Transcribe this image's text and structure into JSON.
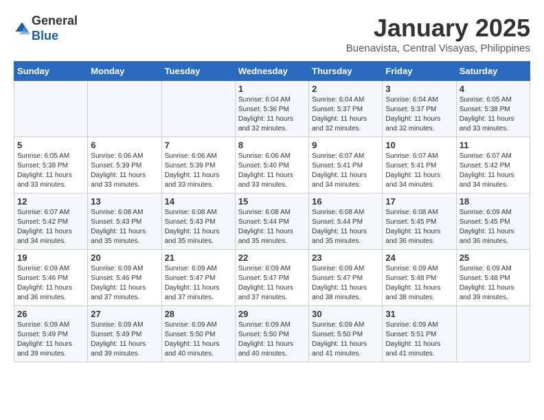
{
  "header": {
    "logo_general": "General",
    "logo_blue": "Blue",
    "month_title": "January 2025",
    "location": "Buenavista, Central Visayas, Philippines"
  },
  "days_of_week": [
    "Sunday",
    "Monday",
    "Tuesday",
    "Wednesday",
    "Thursday",
    "Friday",
    "Saturday"
  ],
  "weeks": [
    [
      {
        "day": "",
        "info": ""
      },
      {
        "day": "",
        "info": ""
      },
      {
        "day": "",
        "info": ""
      },
      {
        "day": "1",
        "info": "Sunrise: 6:04 AM\nSunset: 5:36 PM\nDaylight: 11 hours and 32 minutes."
      },
      {
        "day": "2",
        "info": "Sunrise: 6:04 AM\nSunset: 5:37 PM\nDaylight: 11 hours and 32 minutes."
      },
      {
        "day": "3",
        "info": "Sunrise: 6:04 AM\nSunset: 5:37 PM\nDaylight: 11 hours and 32 minutes."
      },
      {
        "day": "4",
        "info": "Sunrise: 6:05 AM\nSunset: 5:38 PM\nDaylight: 11 hours and 33 minutes."
      }
    ],
    [
      {
        "day": "5",
        "info": "Sunrise: 6:05 AM\nSunset: 5:38 PM\nDaylight: 11 hours and 33 minutes."
      },
      {
        "day": "6",
        "info": "Sunrise: 6:06 AM\nSunset: 5:39 PM\nDaylight: 11 hours and 33 minutes."
      },
      {
        "day": "7",
        "info": "Sunrise: 6:06 AM\nSunset: 5:39 PM\nDaylight: 11 hours and 33 minutes."
      },
      {
        "day": "8",
        "info": "Sunrise: 6:06 AM\nSunset: 5:40 PM\nDaylight: 11 hours and 33 minutes."
      },
      {
        "day": "9",
        "info": "Sunrise: 6:07 AM\nSunset: 5:41 PM\nDaylight: 11 hours and 34 minutes."
      },
      {
        "day": "10",
        "info": "Sunrise: 6:07 AM\nSunset: 5:41 PM\nDaylight: 11 hours and 34 minutes."
      },
      {
        "day": "11",
        "info": "Sunrise: 6:07 AM\nSunset: 5:42 PM\nDaylight: 11 hours and 34 minutes."
      }
    ],
    [
      {
        "day": "12",
        "info": "Sunrise: 6:07 AM\nSunset: 5:42 PM\nDaylight: 11 hours and 34 minutes."
      },
      {
        "day": "13",
        "info": "Sunrise: 6:08 AM\nSunset: 5:43 PM\nDaylight: 11 hours and 35 minutes."
      },
      {
        "day": "14",
        "info": "Sunrise: 6:08 AM\nSunset: 5:43 PM\nDaylight: 11 hours and 35 minutes."
      },
      {
        "day": "15",
        "info": "Sunrise: 6:08 AM\nSunset: 5:44 PM\nDaylight: 11 hours and 35 minutes."
      },
      {
        "day": "16",
        "info": "Sunrise: 6:08 AM\nSunset: 5:44 PM\nDaylight: 11 hours and 35 minutes."
      },
      {
        "day": "17",
        "info": "Sunrise: 6:08 AM\nSunset: 5:45 PM\nDaylight: 11 hours and 36 minutes."
      },
      {
        "day": "18",
        "info": "Sunrise: 6:09 AM\nSunset: 5:45 PM\nDaylight: 11 hours and 36 minutes."
      }
    ],
    [
      {
        "day": "19",
        "info": "Sunrise: 6:09 AM\nSunset: 5:46 PM\nDaylight: 11 hours and 36 minutes."
      },
      {
        "day": "20",
        "info": "Sunrise: 6:09 AM\nSunset: 5:46 PM\nDaylight: 11 hours and 37 minutes."
      },
      {
        "day": "21",
        "info": "Sunrise: 6:09 AM\nSunset: 5:47 PM\nDaylight: 11 hours and 37 minutes."
      },
      {
        "day": "22",
        "info": "Sunrise: 6:09 AM\nSunset: 5:47 PM\nDaylight: 11 hours and 37 minutes."
      },
      {
        "day": "23",
        "info": "Sunrise: 6:09 AM\nSunset: 5:47 PM\nDaylight: 11 hours and 38 minutes."
      },
      {
        "day": "24",
        "info": "Sunrise: 6:09 AM\nSunset: 5:48 PM\nDaylight: 11 hours and 38 minutes."
      },
      {
        "day": "25",
        "info": "Sunrise: 6:09 AM\nSunset: 5:48 PM\nDaylight: 11 hours and 39 minutes."
      }
    ],
    [
      {
        "day": "26",
        "info": "Sunrise: 6:09 AM\nSunset: 5:49 PM\nDaylight: 11 hours and 39 minutes."
      },
      {
        "day": "27",
        "info": "Sunrise: 6:09 AM\nSunset: 5:49 PM\nDaylight: 11 hours and 39 minutes."
      },
      {
        "day": "28",
        "info": "Sunrise: 6:09 AM\nSunset: 5:50 PM\nDaylight: 11 hours and 40 minutes."
      },
      {
        "day": "29",
        "info": "Sunrise: 6:09 AM\nSunset: 5:50 PM\nDaylight: 11 hours and 40 minutes."
      },
      {
        "day": "30",
        "info": "Sunrise: 6:09 AM\nSunset: 5:50 PM\nDaylight: 11 hours and 41 minutes."
      },
      {
        "day": "31",
        "info": "Sunrise: 6:09 AM\nSunset: 5:51 PM\nDaylight: 11 hours and 41 minutes."
      },
      {
        "day": "",
        "info": ""
      }
    ]
  ]
}
